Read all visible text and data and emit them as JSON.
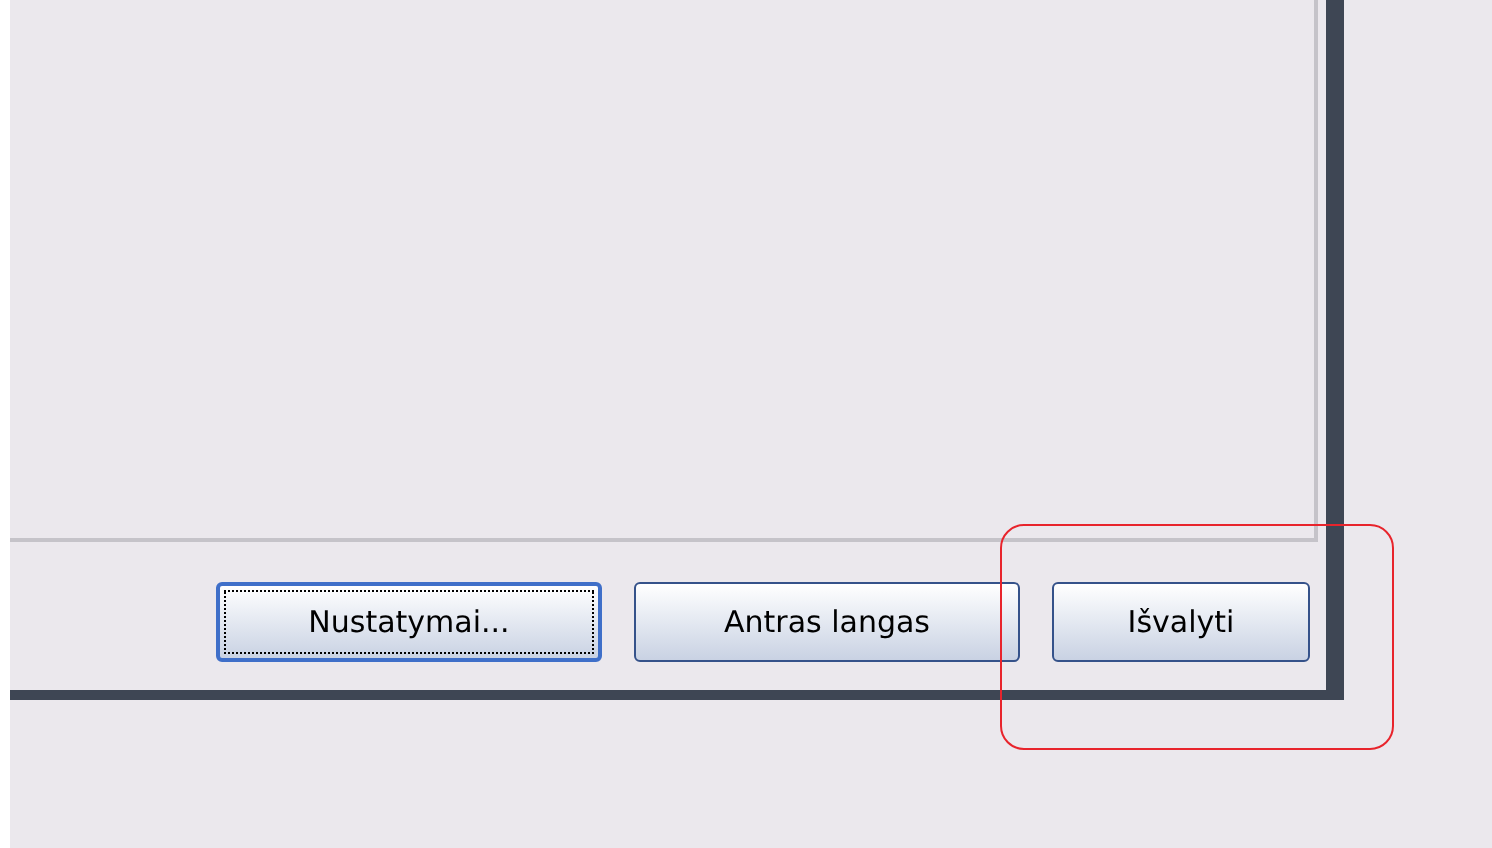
{
  "buttons": [
    {
      "label": "Nustatymai...",
      "focused": true
    },
    {
      "label": "Antras langas",
      "focused": false
    },
    {
      "label": "Išvalyti",
      "focused": false
    }
  ],
  "annotation": {
    "kind": "highlight",
    "color": "#e8242c"
  }
}
